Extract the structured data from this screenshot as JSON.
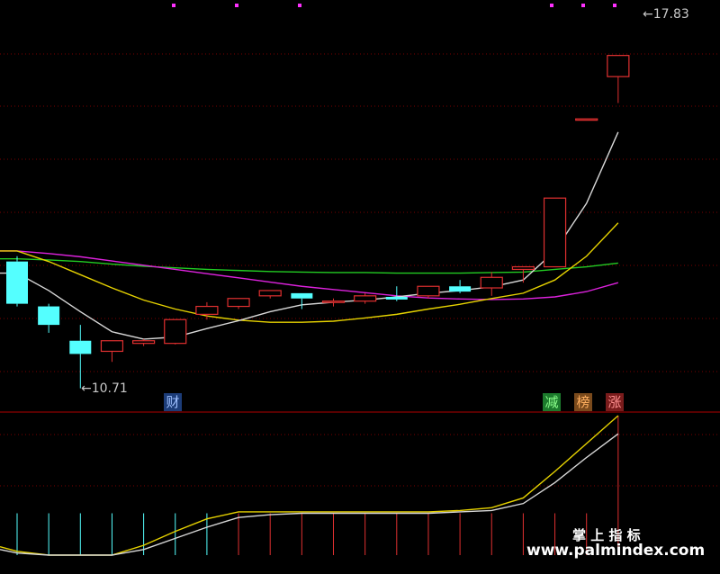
{
  "labels": {
    "high_price": "17.83",
    "low_price": "10.71",
    "badge_cai": "财",
    "badge_jian": "减",
    "badge_bang": "榜",
    "badge_zhang": "涨",
    "watermark_line1": "掌 上 指 标",
    "watermark_line2": "www.palmindex.com"
  },
  "colors": {
    "background": "#000000",
    "up_candle": "#e03030",
    "down_candle": "#54ffff",
    "ma_white": "#d8d8d8",
    "ma_yellow": "#e6d200",
    "ma_green": "#22cc22",
    "ma_magenta": "#dd22dd",
    "grid": "#7a0000",
    "badge_cai_bg": "#1c3c78",
    "badge_jian_bg": "#1c7a2c",
    "badge_bang_bg": "#7a4a1c",
    "badge_zhang_bg": "#7a1c1c"
  },
  "chart_data": {
    "type": "candlestick",
    "ylim": [
      10.3,
      18.1
    ],
    "candles": [
      {
        "open": 13.15,
        "high": 13.25,
        "low": 12.3,
        "close": 12.35
      },
      {
        "open": 12.3,
        "high": 12.35,
        "low": 11.8,
        "close": 11.95
      },
      {
        "open": 11.65,
        "high": 11.95,
        "low": 10.75,
        "close": 11.4
      },
      {
        "open": 11.45,
        "high": 11.65,
        "low": 11.25,
        "close": 11.65
      },
      {
        "open": 11.6,
        "high": 11.68,
        "low": 11.55,
        "close": 11.65
      },
      {
        "open": 11.6,
        "high": 12.05,
        "low": 11.58,
        "close": 12.05
      },
      {
        "open": 12.15,
        "high": 12.38,
        "low": 12.05,
        "close": 12.3
      },
      {
        "open": 12.3,
        "high": 12.45,
        "low": 12.25,
        "close": 12.45
      },
      {
        "open": 12.5,
        "high": 12.6,
        "low": 12.45,
        "close": 12.6
      },
      {
        "open": 12.55,
        "high": 12.55,
        "low": 12.25,
        "close": 12.45
      },
      {
        "open": 12.38,
        "high": 12.45,
        "low": 12.3,
        "close": 12.4
      },
      {
        "open": 12.4,
        "high": 12.55,
        "low": 12.35,
        "close": 12.5
      },
      {
        "open": 12.48,
        "high": 12.68,
        "low": 12.4,
        "close": 12.43
      },
      {
        "open": 12.5,
        "high": 12.68,
        "low": 12.45,
        "close": 12.68
      },
      {
        "open": 12.68,
        "high": 12.8,
        "low": 12.55,
        "close": 12.58
      },
      {
        "open": 12.65,
        "high": 12.95,
        "low": 12.5,
        "close": 12.85
      },
      {
        "open": 13.0,
        "high": 13.05,
        "low": 12.75,
        "close": 13.05
      },
      {
        "open": 13.05,
        "high": 14.35,
        "low": 13.05,
        "close": 14.35
      },
      {
        "open": 15.85,
        "high": 15.85,
        "low": 15.85,
        "close": 15.85
      },
      {
        "open": 16.65,
        "high": 17.05,
        "low": 16.15,
        "close": 17.05
      }
    ],
    "ma_white": [
      12.93,
      12.6,
      12.2,
      11.82,
      11.68,
      11.72,
      11.88,
      12.03,
      12.2,
      12.33,
      12.38,
      12.42,
      12.48,
      12.55,
      12.6,
      12.67,
      12.8,
      13.35,
      14.25,
      15.6
    ],
    "ma_yellow": [
      13.35,
      13.15,
      12.9,
      12.65,
      12.42,
      12.25,
      12.12,
      12.04,
      12.0,
      12.0,
      12.02,
      12.08,
      12.15,
      12.25,
      12.34,
      12.45,
      12.55,
      12.8,
      13.25,
      13.88
    ],
    "ma_green": [
      13.2,
      13.18,
      13.15,
      13.1,
      13.06,
      13.03,
      13.0,
      12.98,
      12.96,
      12.95,
      12.94,
      12.94,
      12.93,
      12.93,
      12.93,
      12.94,
      12.95,
      13.0,
      13.05,
      13.12
    ],
    "ma_magenta": [
      13.35,
      13.3,
      13.24,
      13.16,
      13.08,
      13.0,
      12.92,
      12.84,
      12.76,
      12.68,
      12.62,
      12.56,
      12.5,
      12.46,
      12.44,
      12.43,
      12.44,
      12.48,
      12.58,
      12.75
    ],
    "sub_ylim": [
      0,
      100
    ],
    "sub_bars": [
      30,
      30,
      30,
      30,
      30,
      30,
      30,
      30,
      30,
      30,
      30,
      30,
      30,
      30,
      30,
      30,
      30,
      30,
      30,
      100
    ],
    "sub_yellow": [
      6,
      2.7,
      0,
      0,
      0,
      7,
      17,
      26,
      31,
      31,
      31,
      31,
      31,
      31,
      31,
      32,
      34,
      41,
      60,
      80,
      100
    ],
    "sub_white": [
      4,
      1.5,
      0,
      0,
      0,
      4,
      12,
      20,
      27,
      29,
      30,
      30,
      30,
      30,
      30,
      31,
      32,
      37,
      52,
      70,
      87
    ]
  }
}
